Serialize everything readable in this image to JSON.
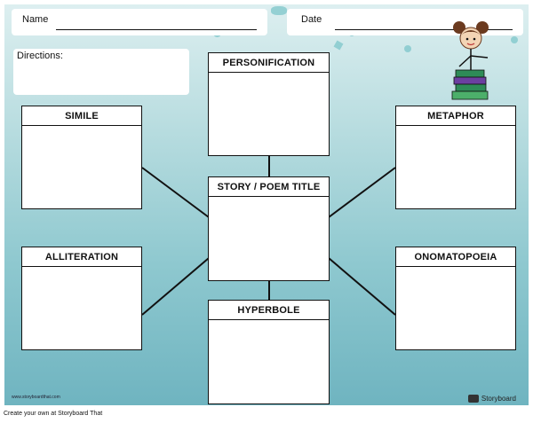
{
  "header": {
    "name_label": "Name",
    "date_label": "Date"
  },
  "directions_label": "Directions:",
  "boxes": {
    "personification": "PERSONIFICATION",
    "simile": "SIMILE",
    "metaphor": "METAPHOR",
    "title": "STORY / POEM TITLE",
    "alliteration": "ALLITERATION",
    "onomatopoeia": "ONOMATOPOEIA",
    "hyperbole": "HYPERBOLE"
  },
  "watermark_url": "www.storyboardthat.com",
  "brand": "Storyboard",
  "footer_text": "Create your own at Storyboard That",
  "colors": {
    "background_top": "#ddeff0",
    "background_bottom": "#6fb4c0",
    "accent_teal": "#7cc6c9",
    "book_green": "#2e8b57",
    "book_purple": "#6b3fa0"
  }
}
